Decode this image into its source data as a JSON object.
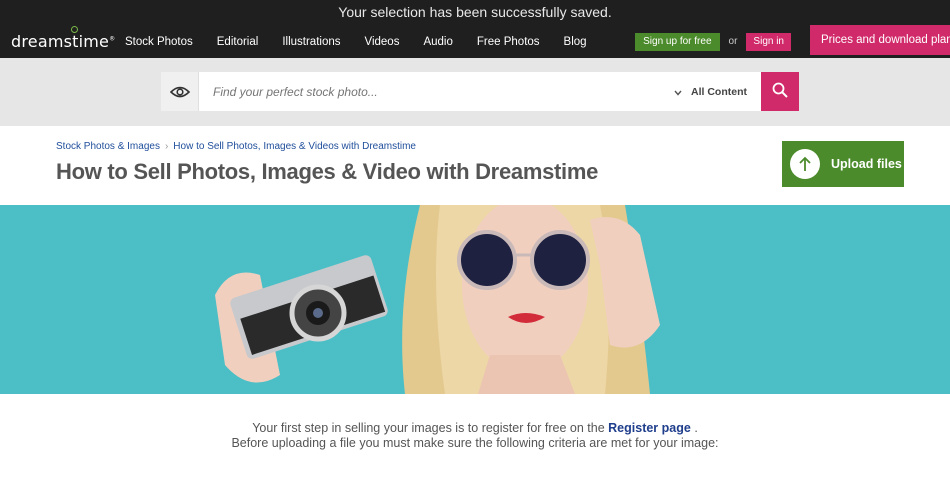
{
  "notice": {
    "text": "Your selection has been successfully saved."
  },
  "navbar": {
    "logo_text": "dreamstime",
    "links": [
      "Stock Photos",
      "Editorial",
      "Illustrations",
      "Videos",
      "Audio",
      "Free Photos",
      "Blog"
    ],
    "signup_label": "Sign up for free",
    "or_text": "or",
    "signin_label": "Sign in",
    "prices_label": "Prices and download plans"
  },
  "search": {
    "placeholder": "Find your perfect stock photo...",
    "content_filter": "All Content",
    "icons": {
      "left": "eye-icon",
      "filter": "chevron-down-icon",
      "submit": "search-icon"
    }
  },
  "page": {
    "breadcrumb": [
      "Stock Photos & Images",
      "How to Sell Photos, Images & Videos with Dreamstime"
    ],
    "title": "How to Sell Photos, Images & Video with Dreamstime",
    "upload_label": "Upload files"
  },
  "intro": {
    "line1_prefix": "Your first step in selling your images is to register for free on the",
    "register_link": "Register page",
    "line1_suffix": ".",
    "line2": "Before uploading a file you must make sure the following criteria are met for your image:"
  },
  "colors": {
    "nav_bg": "#1f1f1f",
    "accent_pink": "#d12a6a",
    "accent_green": "#4c8b2b",
    "hero_bg": "#4cbfc6",
    "link_blue": "#1f4e9b"
  }
}
